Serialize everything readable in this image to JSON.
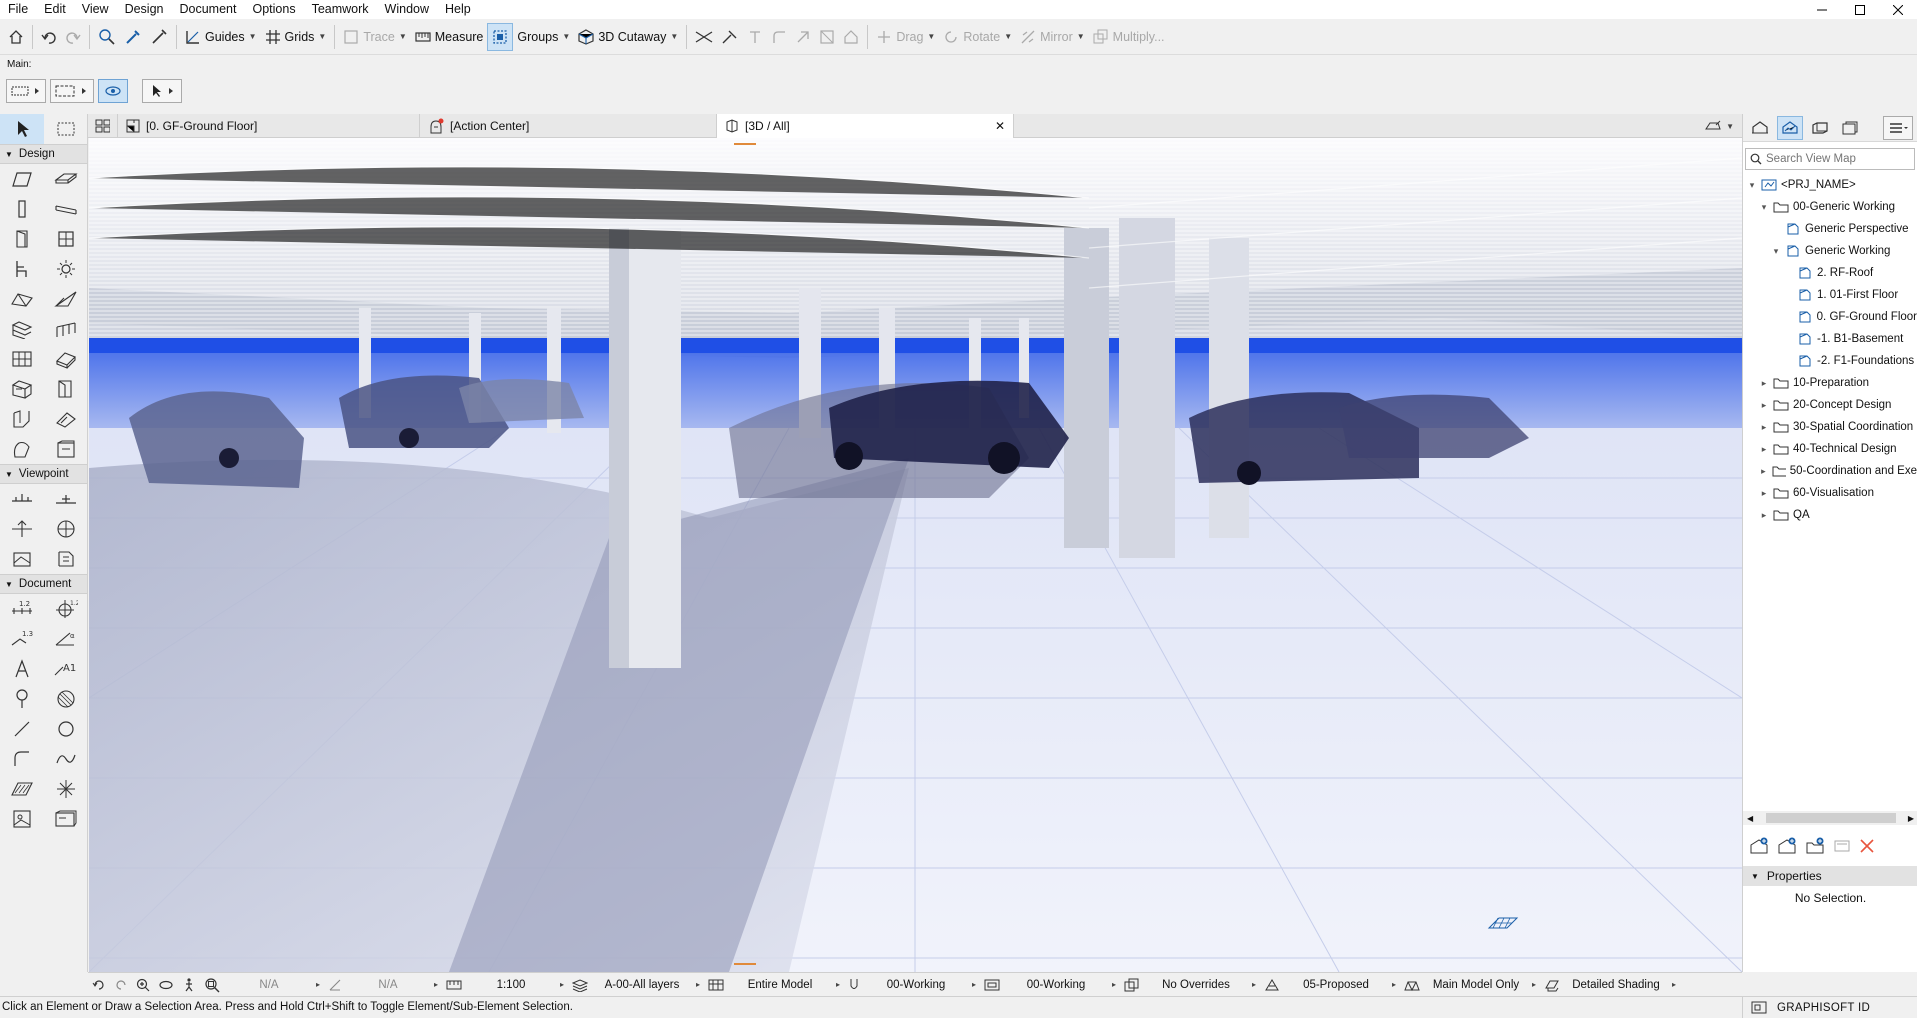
{
  "menu": [
    "File",
    "Edit",
    "View",
    "Design",
    "Document",
    "Options",
    "Teamwork",
    "Window",
    "Help"
  ],
  "toolbar": {
    "guides": "Guides",
    "grids": "Grids",
    "trace": "Trace",
    "measure": "Measure",
    "groups": "Groups",
    "cutaway": "3D Cutaway",
    "drag": "Drag",
    "rotate": "Rotate",
    "mirror": "Mirror",
    "multiply": "Multiply..."
  },
  "infobox": {
    "main_label": "Main:"
  },
  "toolbox": {
    "sections": {
      "design": "Design",
      "viewpoint": "Viewpoint",
      "document": "Document"
    }
  },
  "tabs": [
    {
      "label": "[0. GF-Ground Floor]"
    },
    {
      "label": "[Action Center]"
    },
    {
      "label": "[3D / All]"
    }
  ],
  "navigator": {
    "search_placeholder": "Search View Map",
    "tree": [
      {
        "label": "<PRJ_NAME>",
        "depth": 0,
        "twisty": "open"
      },
      {
        "label": "00-Generic Working",
        "depth": 1,
        "twisty": "open"
      },
      {
        "label": "Generic Perspective",
        "depth": 2,
        "twisty": "none"
      },
      {
        "label": "Generic Working",
        "depth": 2,
        "twisty": "open"
      },
      {
        "label": "2. RF-Roof",
        "depth": 3,
        "twisty": "none"
      },
      {
        "label": "1. 01-First Floor",
        "depth": 3,
        "twisty": "none"
      },
      {
        "label": "0. GF-Ground Floor",
        "depth": 3,
        "twisty": "none"
      },
      {
        "label": "-1. B1-Basement",
        "depth": 3,
        "twisty": "none"
      },
      {
        "label": "-2. F1-Foundations",
        "depth": 3,
        "twisty": "none"
      },
      {
        "label": "10-Preparation",
        "depth": 1,
        "twisty": "closed"
      },
      {
        "label": "20-Concept Design",
        "depth": 1,
        "twisty": "closed"
      },
      {
        "label": "30-Spatial Coordination",
        "depth": 1,
        "twisty": "closed"
      },
      {
        "label": "40-Technical Design",
        "depth": 1,
        "twisty": "closed"
      },
      {
        "label": "50-Coordination and Exe",
        "depth": 1,
        "twisty": "closed"
      },
      {
        "label": "60-Visualisation",
        "depth": 1,
        "twisty": "closed"
      },
      {
        "label": "QA",
        "depth": 1,
        "twisty": "closed"
      }
    ],
    "properties_title": "Properties",
    "no_selection": "No Selection."
  },
  "viewbar": {
    "na1": "N/A",
    "na2": "N/A",
    "scale": "1:100",
    "layers": "A-00-All layers",
    "model": "Entire Model",
    "pen_set": "00-Working",
    "model_view": "00-Working",
    "overrides": "No Overrides",
    "renovation": "05-Proposed",
    "filter": "Main Model Only",
    "shading": "Detailed Shading"
  },
  "status": {
    "message": "Click an Element or Draw a Selection Area. Press and Hold Ctrl+Shift to Toggle Element/Sub-Element Selection.",
    "graphisoft_id": "GRAPHISOFT ID"
  }
}
